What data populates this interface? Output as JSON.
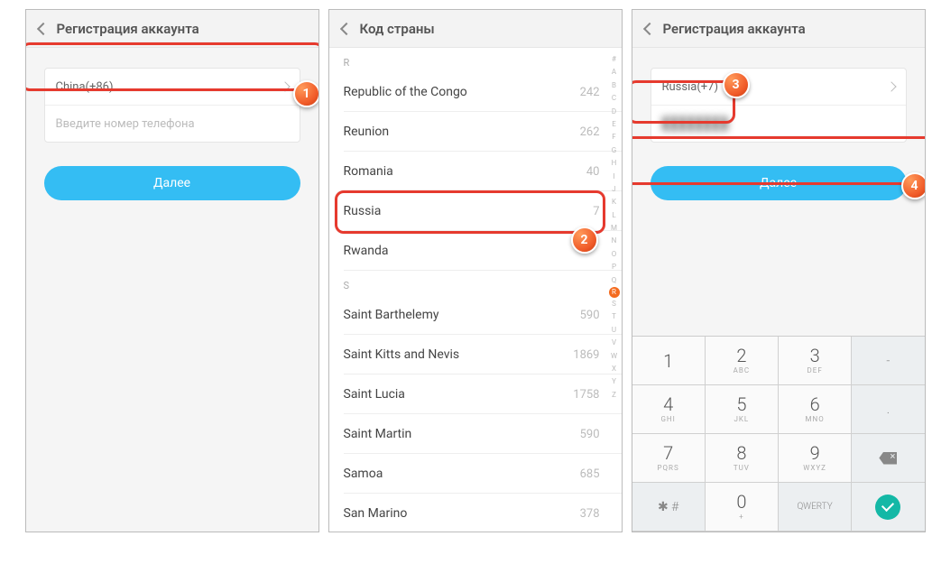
{
  "p1": {
    "title": "Регистрация аккаунта",
    "country": "China(+86)",
    "placeholder": "Введите номер телефона",
    "next": "Далее"
  },
  "p2": {
    "title": "Код страны",
    "sectR": "R",
    "sectS": "S",
    "items": [
      {
        "n": "Republic of the Congo",
        "c": "242"
      },
      {
        "n": "Reunion",
        "c": "262"
      },
      {
        "n": "Romania",
        "c": "40"
      },
      {
        "n": "Russia",
        "c": "7"
      },
      {
        "n": "Rwanda",
        "c": ""
      }
    ],
    "sitems": [
      {
        "n": "Saint Barthelemy",
        "c": "590"
      },
      {
        "n": "Saint Kitts and Nevis",
        "c": "1869"
      },
      {
        "n": "Saint Lucia",
        "c": "1758"
      },
      {
        "n": "Saint Martin",
        "c": "590"
      },
      {
        "n": "Samoa",
        "c": "685"
      },
      {
        "n": "San Marino",
        "c": "378"
      }
    ],
    "index": [
      "#",
      "A",
      "B",
      "C",
      "D",
      "E",
      "F",
      "G",
      "H",
      "I",
      "J",
      "K",
      "L",
      "M",
      "N",
      "O",
      "P",
      "Q",
      "R",
      "S",
      "T",
      "U",
      "V",
      "W",
      "X",
      "Y",
      "Z"
    ]
  },
  "p3": {
    "title": "Регистрация аккаунта",
    "country": "Russia(+7)",
    "masked": "████████",
    "next": "Далее",
    "keys": [
      [
        {
          "n": "1",
          "l": ""
        },
        {
          "n": "2",
          "l": "ABC"
        },
        {
          "n": "3",
          "l": "DEF"
        },
        {
          "n": "-",
          "l": "",
          "util": true
        }
      ],
      [
        {
          "n": "4",
          "l": "GHI"
        },
        {
          "n": "5",
          "l": "JKL"
        },
        {
          "n": "6",
          "l": "MNO"
        },
        {
          "n": ".",
          "l": "",
          "util": true
        }
      ],
      [
        {
          "n": "7",
          "l": "PQRS"
        },
        {
          "n": "8",
          "l": "TUV"
        },
        {
          "n": "9",
          "l": "WXYZ"
        },
        {
          "n": "bsp",
          "util": true
        }
      ],
      [
        {
          "n": "✱ #",
          "l": "",
          "util": true
        },
        {
          "n": "0",
          "l": "+"
        },
        {
          "n": "QWERTY",
          "l": "",
          "util": true,
          "small": true
        },
        {
          "n": "ok",
          "util": true
        }
      ]
    ]
  },
  "badges": {
    "b1": "1",
    "b2": "2",
    "b3": "3",
    "b4": "4"
  }
}
